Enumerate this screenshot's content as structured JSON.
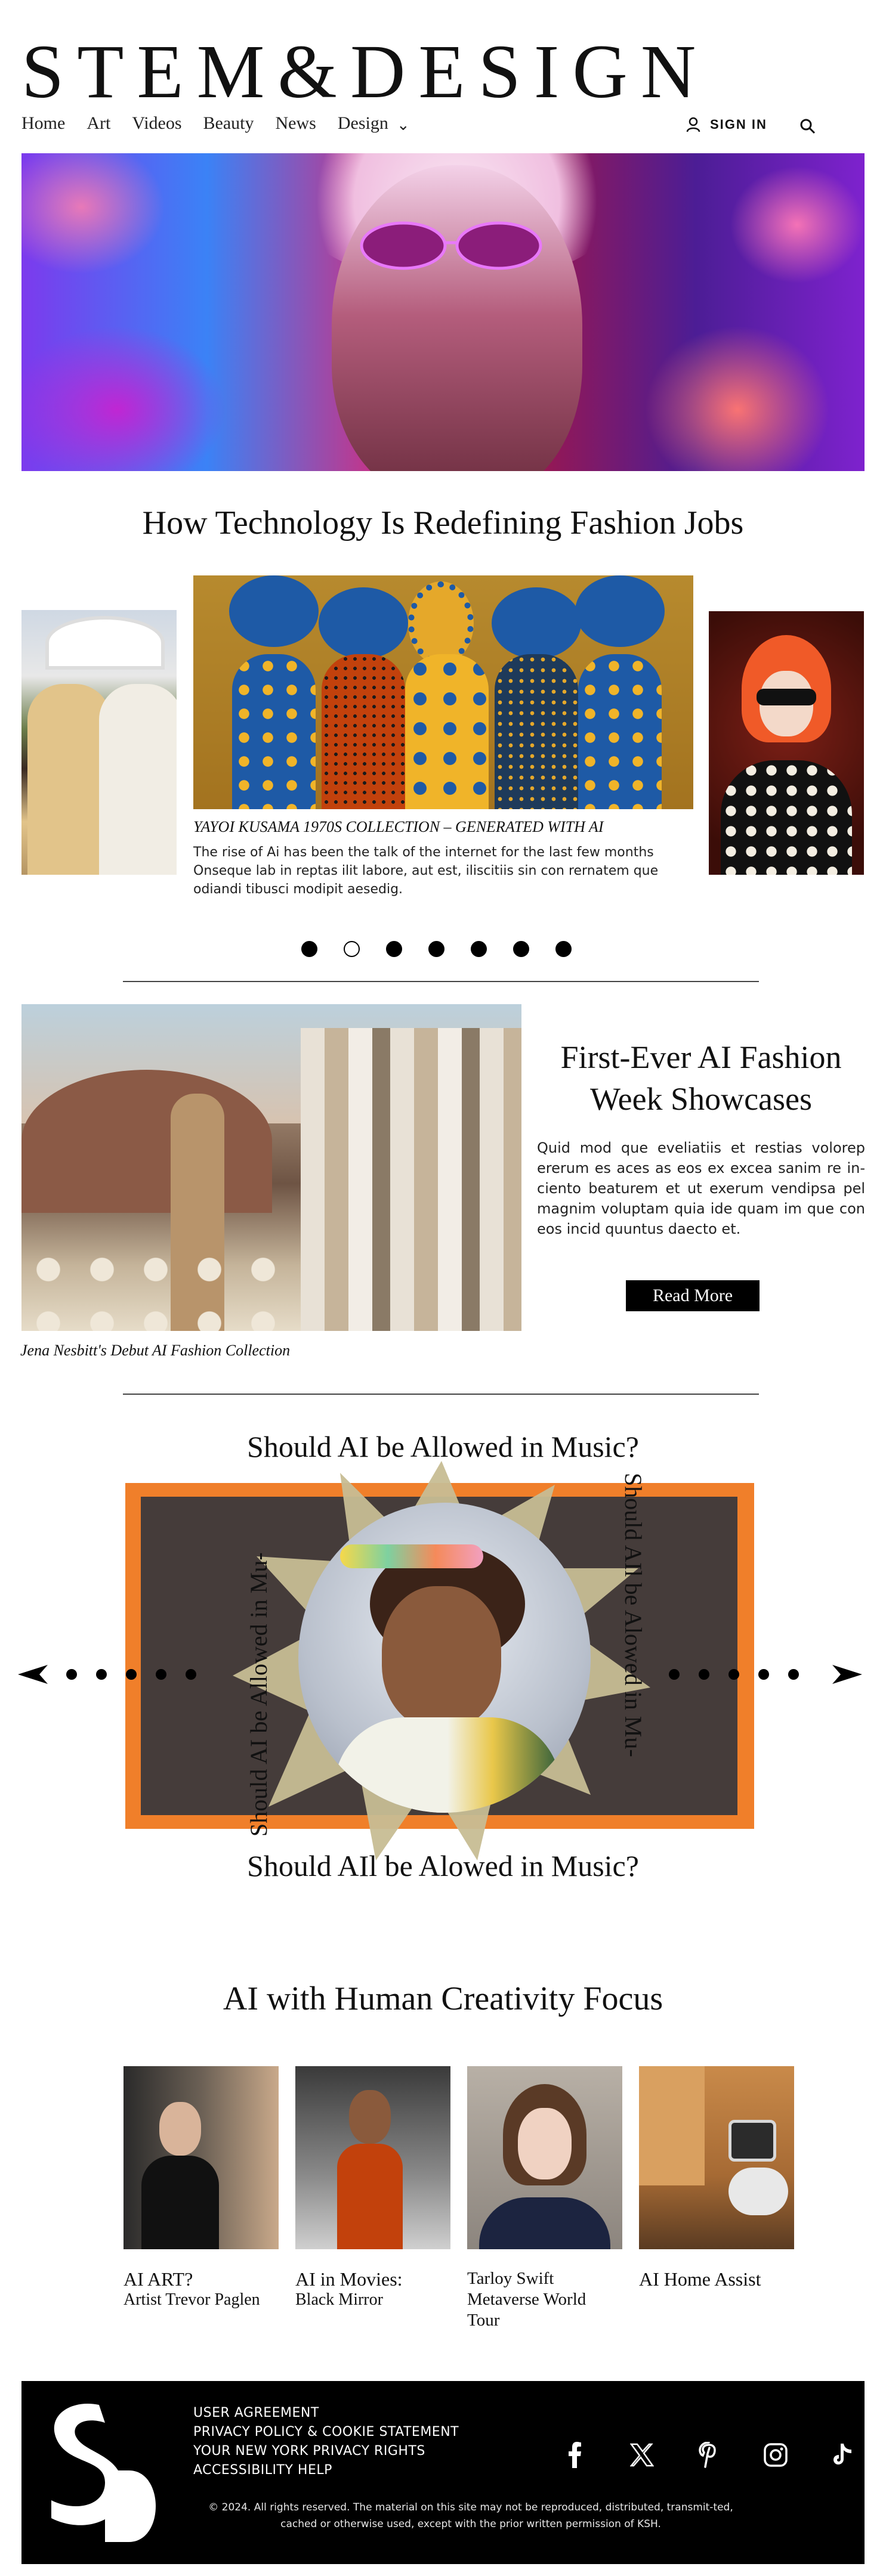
{
  "header": {
    "logo": "STEM&DESIGN",
    "nav": [
      "Home",
      "Art",
      "Videos",
      "Beauty",
      "News",
      "Design"
    ],
    "sign_in": "SIGN IN"
  },
  "featured": {
    "title": "How Technology Is Redefining Fashion Jobs",
    "caption": "YAYOI KUSAMA 1970S COLLECTION – GENERATED WITH AI",
    "body": "The rise of Ai has been the talk of the internet for the last few months Onseque lab in reptas ilit labore, aut est, iliscitiis sin con rernatem que odiandi tibusci modipit aesedig.",
    "dots": [
      true,
      false,
      true,
      true,
      true,
      true,
      true
    ]
  },
  "article": {
    "title": "First-Ever AI Fashion Week Showcases",
    "body": "Quid mod que eveliatiis et restias volorep ererum es aces as eos ex excea sanim re in-ciento beaturem et ut exerum vendipsa pel magnim voluptam quia ide quam im que con eos incid quuntus daecto et.",
    "cta": "Read More",
    "caption": "Jena Nesbitt's Debut AI Fashion Collection"
  },
  "music": {
    "title_top": "Should AI be Allowed in Music?",
    "title_bottom": "Should AIl be Alowed in Music?",
    "vert_left": "Should AI be Allowed in Mu-",
    "vert_right": "Should AIl be Alowed in Mu-"
  },
  "creativity": {
    "title": "AI with Human Creativity Focus",
    "cards": [
      {
        "line1": "AI ART?",
        "line2": "Artist Trevor Paglen"
      },
      {
        "line1": "AI in Movies:",
        "line2": "Black Mirror"
      },
      {
        "line1": "Tarloy Swift Metaverse World Tour",
        "line2": ""
      },
      {
        "line1": "AI Home Assist",
        "line2": ""
      }
    ]
  },
  "footer": {
    "links": [
      "USER AGREEMENT",
      "PRIVACY POLICY & COOKIE STATEMENT",
      "YOUR NEW YORK PRIVACY RIGHTS",
      "ACCESSIBILITY HELP"
    ],
    "copyright": "© 2024. All rights reserved. The material on this site may not be reproduced, distributed, transmit-ted, cached or otherwise used, except with the prior written permission of KSH.",
    "social": [
      "facebook-icon",
      "x-icon",
      "pinterest-icon",
      "instagram-icon",
      "tiktok-icon"
    ]
  }
}
